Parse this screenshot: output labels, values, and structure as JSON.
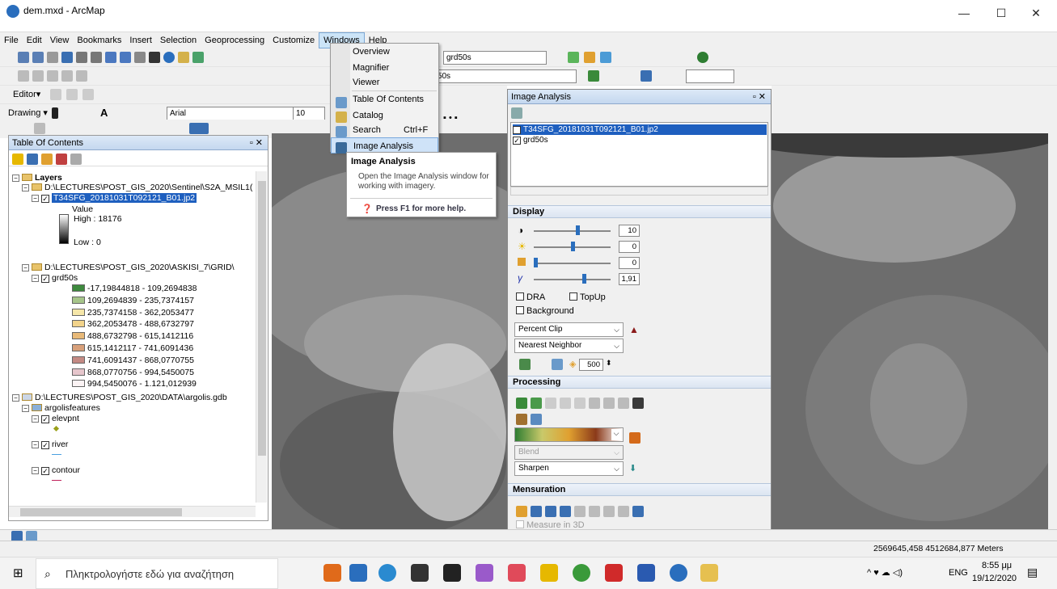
{
  "window": {
    "title": "dem.mxd - ArcMap",
    "minimize": "—",
    "maximize": "☐",
    "close": "✕"
  },
  "menubar": [
    "File",
    "Edit",
    "View",
    "Bookmarks",
    "Insert",
    "Selection",
    "Geoprocessing",
    "Customize",
    "Windows",
    "Help"
  ],
  "toolbars": {
    "layer_combo": "grd50s",
    "layer_combo2": "rd50s",
    "editor": "Editor▾",
    "drawing": "Drawing ▾",
    "font": "Arial",
    "font_size": "10"
  },
  "windows_menu": {
    "items": [
      {
        "label": "Overview",
        "shortcut": ""
      },
      {
        "label": "Magnifier",
        "shortcut": ""
      },
      {
        "label": "Viewer",
        "shortcut": ""
      },
      {
        "label": "Table Of Contents",
        "shortcut": ""
      },
      {
        "label": "Catalog",
        "shortcut": ""
      },
      {
        "label": "Search",
        "shortcut": "Ctrl+F"
      },
      {
        "label": "Image Analysis",
        "shortcut": ""
      }
    ]
  },
  "tooltip": {
    "title": "Image Analysis",
    "body": "Open the Image Analysis window for working with imagery.",
    "help": "Press F1 for more help."
  },
  "toc": {
    "title": "Table Of Contents",
    "layers_label": "Layers",
    "group1": "D:\\LECTURES\\POST_GIS_2020\\Sentinel\\S2A_MSIL1(",
    "raster": "T34SFG_20181031T092121_B01.jp2",
    "value_label": "Value",
    "high": "High : 18176",
    "low": "Low : 0",
    "group2": "D:\\LECTURES\\POST_GIS_2020\\ASKISI_7\\GRID\\",
    "grid": "grd50s",
    "classes": [
      {
        "label": "-17,19844818 - 109,2694838",
        "color": "#3e8a3e"
      },
      {
        "label": "109,2694839 - 235,7374157",
        "color": "#a6c58a"
      },
      {
        "label": "235,7374158 - 362,2053477",
        "color": "#f5e6a8"
      },
      {
        "label": "362,2053478 - 488,6732797",
        "color": "#f2d38a"
      },
      {
        "label": "488,6732798 - 615,1412116",
        "color": "#e8b978"
      },
      {
        "label": "615,1412117 - 741,6091436",
        "color": "#d8a07a"
      },
      {
        "label": "741,6091437 - 868,0770755",
        "color": "#c48a84"
      },
      {
        "label": "868,0770756 - 994,5450075",
        "color": "#e6c6cc"
      },
      {
        "label": "994,5450076 - 1.121,012939",
        "color": "#fbf3f4"
      }
    ],
    "group3": "D:\\LECTURES\\POST_GIS_2020\\DATA\\argolis.gdb",
    "dataset": "argolisfeatures",
    "fc1": "elevpnt",
    "fc2": "river",
    "fc3": "contour"
  },
  "image_analysis": {
    "title": "Image Analysis",
    "layers": [
      "T34SFG_20181031T092121_B01.jp2",
      "grd50s"
    ],
    "display_label": "Display",
    "contrast": "10",
    "brightness": "0",
    "transparency": "0",
    "gamma": "1,91",
    "dra": "DRA",
    "topup": "TopUp",
    "background": "Background",
    "stretch": "Percent Clip",
    "resample": "Nearest Neighbor",
    "zoom": "500",
    "processing_label": "Processing",
    "blend": "Blend",
    "sharpen": "Sharpen",
    "mensuration_label": "Mensuration",
    "measure3d": "Measure in 3D"
  },
  "status": {
    "coords": "2569645,458  4512684,877 Meters"
  },
  "taskbar": {
    "search": "Πληκτρολογήστε εδώ για αναζήτηση",
    "lang": "ENG",
    "time": "8:55 μμ",
    "date": "19/12/2020"
  }
}
